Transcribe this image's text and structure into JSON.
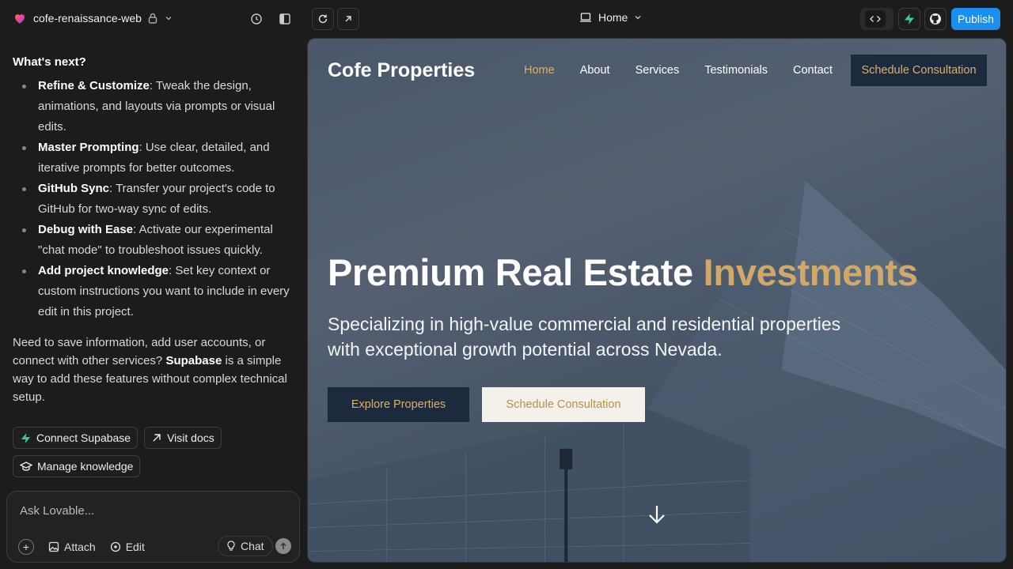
{
  "topbar": {
    "project_name": "cofe-renaissance-web",
    "page_label": "Home",
    "publish_label": "Publish"
  },
  "chat": {
    "heading": "What's next?",
    "items": [
      {
        "title": "Refine & Customize",
        "text": ": Tweak the design, animations, and layouts via prompts or visual edits."
      },
      {
        "title": "Master Prompting",
        "text": ": Use clear, detailed, and iterative prompts for better outcomes."
      },
      {
        "title": "GitHub Sync",
        "text": ": Transfer your project's code to GitHub for two-way sync of edits."
      },
      {
        "title": "Debug with Ease",
        "text": ": Activate our experimental \"chat mode\" to troubleshoot issues quickly."
      },
      {
        "title": "Add project knowledge",
        "text": ": Set key context or custom instructions you want to include in every edit in this project."
      }
    ],
    "supabase_pre": "Need to save information, add user accounts, or connect with other services? ",
    "supabase_bold": "Supabase",
    "supabase_post": " is a simple way to add these features without complex technical setup.",
    "chips": {
      "connect_supabase": "Connect Supabase",
      "visit_docs": "Visit docs",
      "manage_knowledge": "Manage knowledge"
    }
  },
  "composer": {
    "placeholder": "Ask Lovable...",
    "attach_label": "Attach",
    "edit_label": "Edit",
    "chat_label": "Chat"
  },
  "site": {
    "logo": "Cofe Properties",
    "nav": {
      "home": "Home",
      "about": "About",
      "services": "Services",
      "testimonials": "Testimonials",
      "contact": "Contact",
      "cta": "Schedule Consultation"
    },
    "hero": {
      "title_main": "Premium Real Estate ",
      "title_accent": "Investments",
      "subtitle": "Specializing in high-value commercial and residential properties with exceptional growth potential across Nevada.",
      "primary_button": "Explore Properties",
      "secondary_button": "Schedule Consultation"
    },
    "colors": {
      "gold": "#d8b06a",
      "navy": "#1c2a3d"
    }
  }
}
